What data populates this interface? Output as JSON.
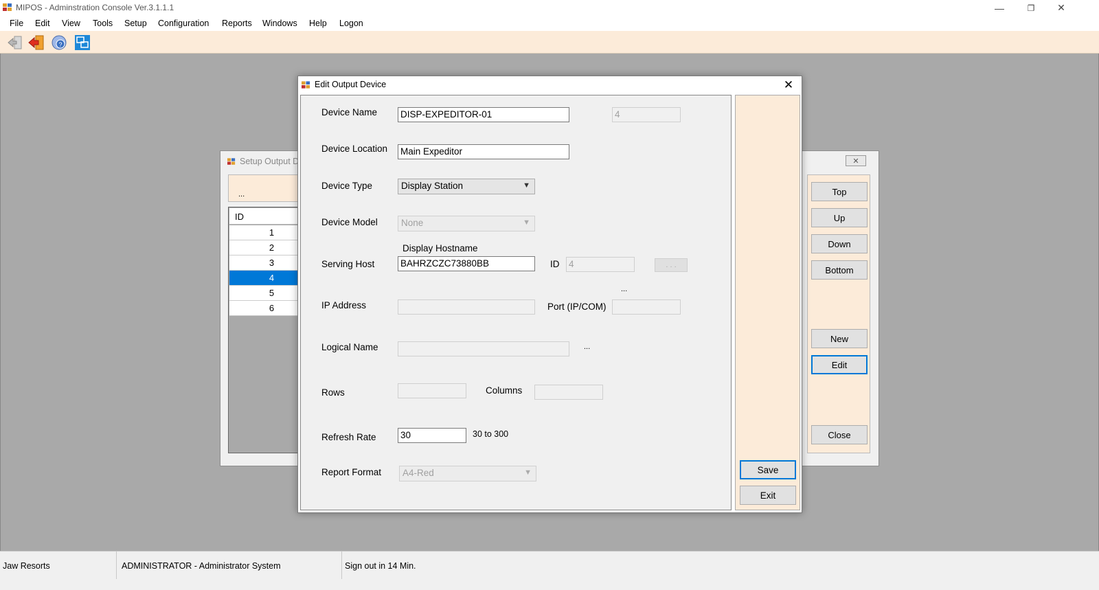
{
  "app": {
    "title": "MIPOS - Adminstration Console Ver.3.1.1.1",
    "window_controls": {
      "minimize": "—",
      "restore": "❐",
      "close": "✕"
    }
  },
  "menu": [
    "File",
    "Edit",
    "View",
    "Tools",
    "Setup",
    "Configuration",
    "Reports",
    "Windows",
    "Help",
    "Logon"
  ],
  "toolbar": {
    "icons": [
      "logout-icon",
      "exit-icon",
      "help-globe-icon",
      "window-switch-icon"
    ]
  },
  "back_window": {
    "title": "Setup Output D",
    "header_text": "...",
    "close_label": "✕",
    "grid": {
      "column": "ID",
      "rows": [
        "1",
        "2",
        "3",
        "4",
        "5",
        "6"
      ],
      "selected_index": 3
    },
    "buttons": {
      "top": "Top",
      "up": "Up",
      "down": "Down",
      "bottom": "Bottom",
      "new": "New",
      "edit": "Edit",
      "close": "Close"
    }
  },
  "dialog": {
    "title": "Edit Output Device",
    "close_label": "✕",
    "labels": {
      "device_name": "Device Name",
      "device_location": "Device Location",
      "device_type": "Device Type",
      "device_model": "Device Model",
      "display_hostname": "Display Hostname",
      "serving_host": "Serving Host",
      "id": "ID",
      "ip_address": "IP Address",
      "port": "Port (IP/COM)",
      "logical_name": "Logical Name",
      "rows": "Rows",
      "columns": "Columns",
      "refresh_rate": "Refresh Rate",
      "refresh_hint": "30 to 300",
      "report_format": "Report Format"
    },
    "values": {
      "device_name": "DISP-EXPEDITOR-01",
      "device_id": "4",
      "device_location": "Main Expeditor",
      "device_type": "Display Station",
      "device_model": "None",
      "serving_host": "BAHRZCZC73880BB",
      "host_id": "4",
      "host_browse": ". . .",
      "port_dots": "...",
      "ip_address": "",
      "port": "",
      "logical_name": "",
      "logical_dots": "...",
      "rows": "",
      "columns": "",
      "refresh_rate": "30",
      "report_format": "A4-Red"
    },
    "buttons": {
      "save": "Save",
      "exit": "Exit"
    }
  },
  "status": {
    "company": "Jaw Resorts",
    "user": "ADMINISTRATOR - Administrator System",
    "signout": "Sign out in 14 Min."
  }
}
